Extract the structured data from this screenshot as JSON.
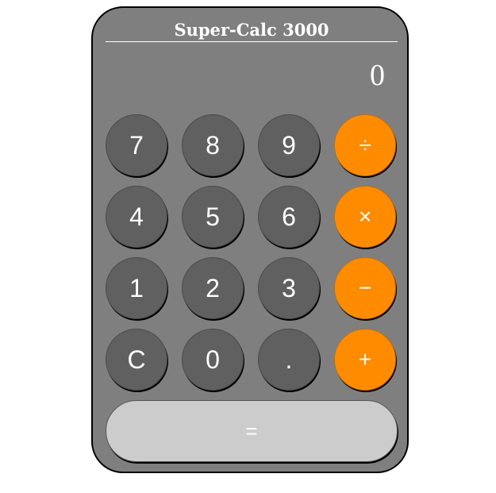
{
  "calculator": {
    "title": "Super-Calc 3000",
    "display_value": "0",
    "keys": {
      "seven": "7",
      "eight": "8",
      "nine": "9",
      "divide": "÷",
      "four": "4",
      "five": "5",
      "six": "6",
      "multiply": "×",
      "one": "1",
      "two": "2",
      "three": "3",
      "subtract": "−",
      "clear": "C",
      "zero": "0",
      "decimal": ".",
      "add": "+",
      "equals": "="
    }
  },
  "colors": {
    "body": "#7f7f7f",
    "number_key": "#606060",
    "operator_key": "#ff8c00",
    "equals_key": "#cccccc",
    "text": "#ffffff"
  }
}
